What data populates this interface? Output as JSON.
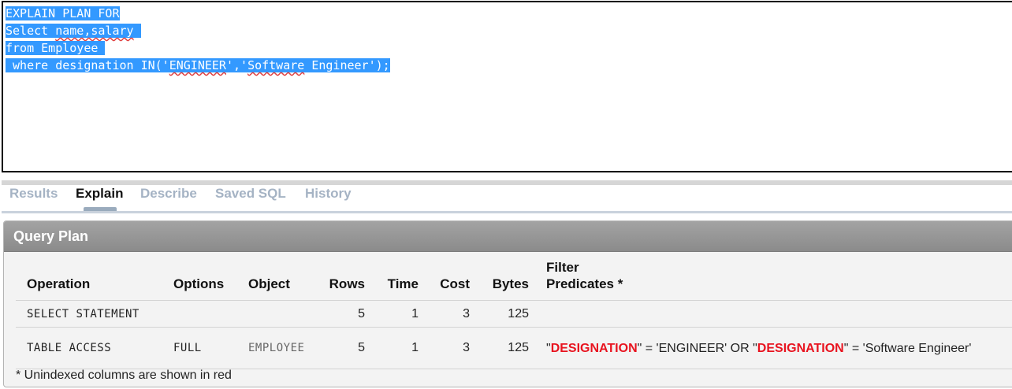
{
  "editor": {
    "lines": [
      "EXPLAIN PLAN FOR",
      "Select name,salary ",
      "from Employee ",
      " where designation IN('ENGINEER','Software Engineer');"
    ],
    "line2_prefix": "Select ",
    "line2_word": "name,salary",
    "line2_suffix": " ",
    "line4_prefix": " where designation IN('",
    "line4_word1": "ENGINEER",
    "line4_mid": "','",
    "line4_word2": "Software",
    "line4_suffix": " Engineer');"
  },
  "tabs": [
    {
      "label": "Results",
      "active": false
    },
    {
      "label": "Explain",
      "active": true
    },
    {
      "label": "Describe",
      "active": false
    },
    {
      "label": "Saved SQL",
      "active": false
    },
    {
      "label": "History",
      "active": false
    }
  ],
  "panel": {
    "title": "Query Plan",
    "columns": {
      "operation": "Operation",
      "options": "Options",
      "object": "Object",
      "rows": "Rows",
      "time": "Time",
      "cost": "Cost",
      "bytes": "Bytes",
      "filter_line1": "Filter",
      "filter_line2": "Predicates *"
    },
    "rows": [
      {
        "operation": "SELECT STATEMENT",
        "options": "",
        "object": "",
        "rows": "5",
        "time": "1",
        "cost": "3",
        "bytes": "125",
        "filter": ""
      },
      {
        "operation": "TABLE ACCESS",
        "options": "FULL",
        "object": "EMPLOYEE",
        "rows": "5",
        "time": "1",
        "cost": "3",
        "bytes": "125",
        "filter_parts": [
          "\"",
          "DESIGNATION",
          "\" = 'ENGINEER' OR \"",
          "DESIGNATION",
          "\" = 'Software Engineer'"
        ]
      }
    ],
    "footnote": "* Unindexed columns are shown in red"
  },
  "colors": {
    "selection": "#3399ff",
    "tab_inactive": "#a5b3c4",
    "unindexed": "#e8131f",
    "header": "#999999"
  }
}
